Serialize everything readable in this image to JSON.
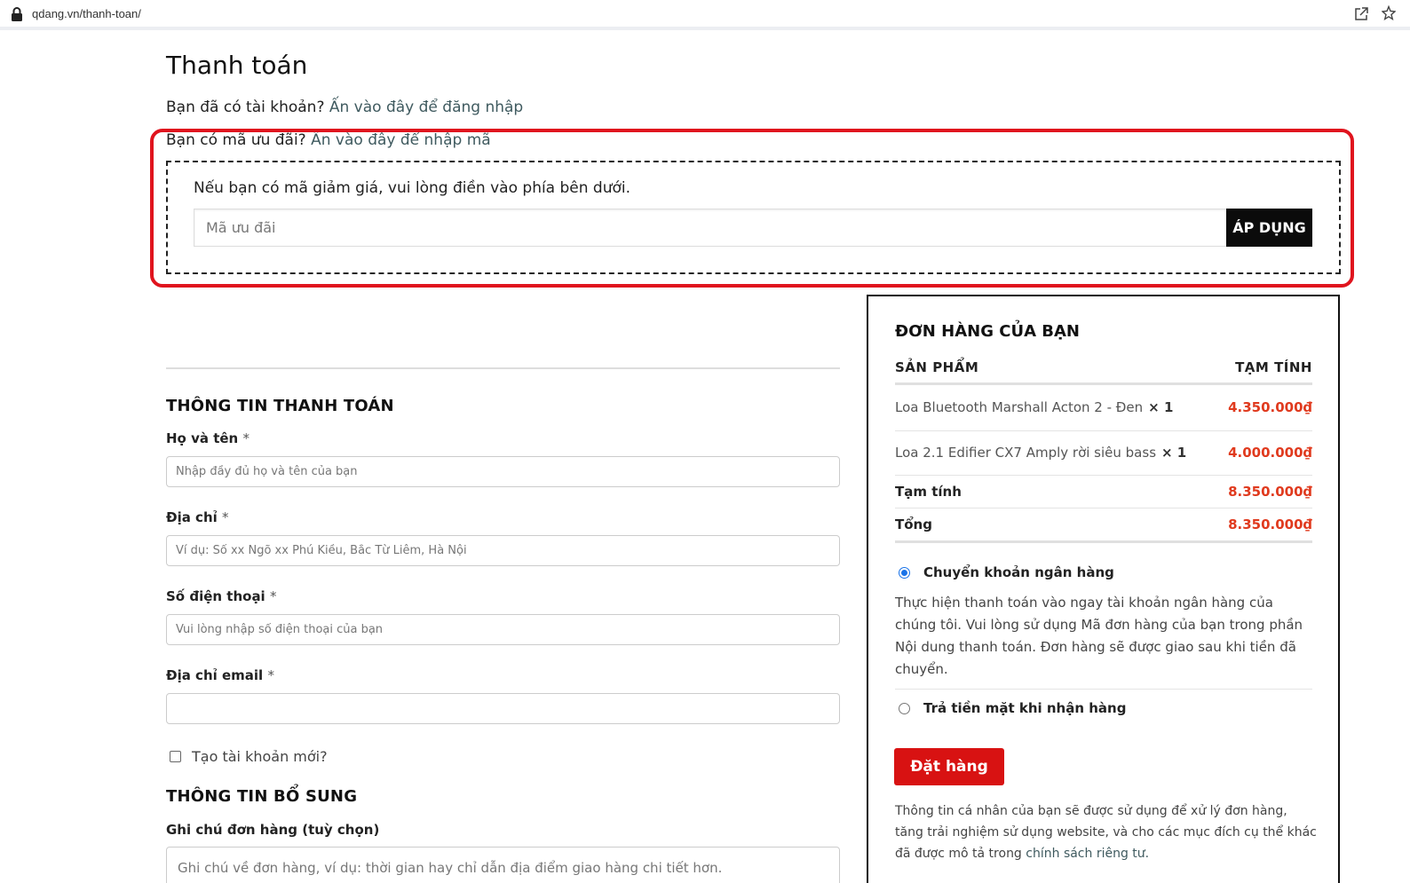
{
  "browser": {
    "url": "qdang.vn/thanh-toan/"
  },
  "page": {
    "title": "Thanh toán",
    "login_notice": "Bạn đã có tài khoản?",
    "login_link": "Ấn vào đây để đăng nhập",
    "coupon_notice": "Bạn có mã ưu đãi?",
    "coupon_link": "Ấn vào đây để nhập mã"
  },
  "coupon": {
    "hint": "Nếu bạn có mã giảm giá, vui lòng điền vào phía bên dưới.",
    "placeholder": "Mã ưu đãi",
    "apply_label": "ÁP DỤNG"
  },
  "billing": {
    "section_title": "THÔNG TIN THANH TOÁN",
    "required_mark": "*",
    "fields": [
      {
        "label": "Họ và tên",
        "placeholder": "Nhập đầy đủ họ và tên của bạn"
      },
      {
        "label": "Địa chỉ",
        "placeholder": "Ví dụ: Số xx Ngõ xx Phú Kiều, Bắc Từ Liêm, Hà Nội"
      },
      {
        "label": "Số điện thoại",
        "placeholder": "Vui lòng nhập số điện thoại của bạn"
      },
      {
        "label": "Địa chỉ email",
        "placeholder": ""
      }
    ],
    "create_account_label": "Tạo tài khoản mới?"
  },
  "additional": {
    "section_title": "THÔNG TIN BỔ SUNG",
    "notes_label": "Ghi chú đơn hàng (tuỳ chọn)",
    "notes_placeholder": "Ghi chú về đơn hàng, ví dụ: thời gian hay chỉ dẫn địa điểm giao hàng chi tiết hơn."
  },
  "order": {
    "title": "ĐƠN HÀNG CỦA BẠN",
    "col_product": "SẢN PHẨM",
    "col_subtotal": "TẠM TÍNH",
    "items": [
      {
        "name": "Loa Bluetooth Marshall Acton 2 - Đen",
        "qty": "× 1",
        "price": "4.350.000₫"
      },
      {
        "name": "Loa 2.1 Edifier CX7 Amply rời siêu bass",
        "qty": "× 1",
        "price": "4.000.000₫"
      }
    ],
    "subtotal_label": "Tạm tính",
    "subtotal_value": "8.350.000₫",
    "total_label": "Tổng",
    "total_value": "8.350.000₫",
    "payment_methods": [
      {
        "label": "Chuyển khoản ngân hàng",
        "selected": true
      },
      {
        "label": "Trả tiền mặt khi nhận hàng",
        "selected": false
      }
    ],
    "bank_desc": "Thực hiện thanh toán vào ngay tài khoản ngân hàng của chúng tôi. Vui lòng sử dụng Mã đơn hàng của bạn trong phần Nội dung thanh toán. Đơn hàng sẽ được giao sau khi tiền đã chuyển.",
    "place_order_label": "Đặt hàng",
    "privacy_text": "Thông tin cá nhân của bạn sẽ được sử dụng để xử lý đơn hàng, tăng trải nghiệm sử dụng website, và cho các mục đích cụ thể khác đã được mô tả trong",
    "privacy_link": "chính sách riêng tư."
  },
  "colors": {
    "highlight": "#e0141e",
    "price": "#e03a1e",
    "order_button": "#d81212",
    "apply_button": "#0b0b0b",
    "radio_selected": "#1a73e8"
  }
}
